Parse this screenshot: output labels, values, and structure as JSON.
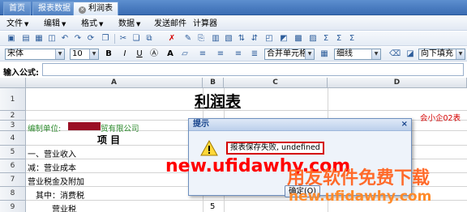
{
  "tabs": [
    {
      "label": "首页",
      "active": false
    },
    {
      "label": "报表数据",
      "active": false
    },
    {
      "label": "利润表",
      "active": true
    }
  ],
  "menus": [
    {
      "label": "文件",
      "has_caret": true
    },
    {
      "label": "编辑",
      "has_caret": true
    },
    {
      "label": "格式",
      "has_caret": true
    },
    {
      "label": "数据",
      "has_caret": true
    },
    {
      "label": "发送邮件",
      "has_caret": false
    },
    {
      "label": "计算器",
      "has_caret": false
    }
  ],
  "format_bar": {
    "font_name": "宋体",
    "font_size": "10",
    "bold": "B",
    "italic": "I",
    "underline": "U",
    "merge": "合并单元格",
    "border_style": "细线",
    "fill_direction": "向下填充"
  },
  "formula": {
    "label": "输入公式:",
    "value": ""
  },
  "grid": {
    "columns": [
      "A",
      "B",
      "C",
      "D"
    ],
    "rows": [
      "1",
      "2",
      "3",
      "4",
      "5",
      "6",
      "7",
      "8",
      "9"
    ],
    "title": "利润表",
    "company_label": "编制单位:",
    "company_name": "贸有限公司",
    "unit_label": "会小企02表",
    "header_item": "项    目",
    "items": [
      "一、营业收入",
      "减：营业成本",
      "营业税金及附加",
      "其中：消费税",
      "营业税"
    ],
    "b_value_row9": "5"
  },
  "dialog": {
    "title": "提示",
    "close": "×",
    "message": "报表保存失败, undefined",
    "ok_label": "确定(O)"
  },
  "watermark": {
    "line1": "new.ufidawhy.com",
    "line2": "用友软件免费下载",
    "line3": "new.ufidawhy.com"
  },
  "colors": {
    "accent": "#15428b",
    "red": "#d40000",
    "green": "#2e8b2e"
  }
}
